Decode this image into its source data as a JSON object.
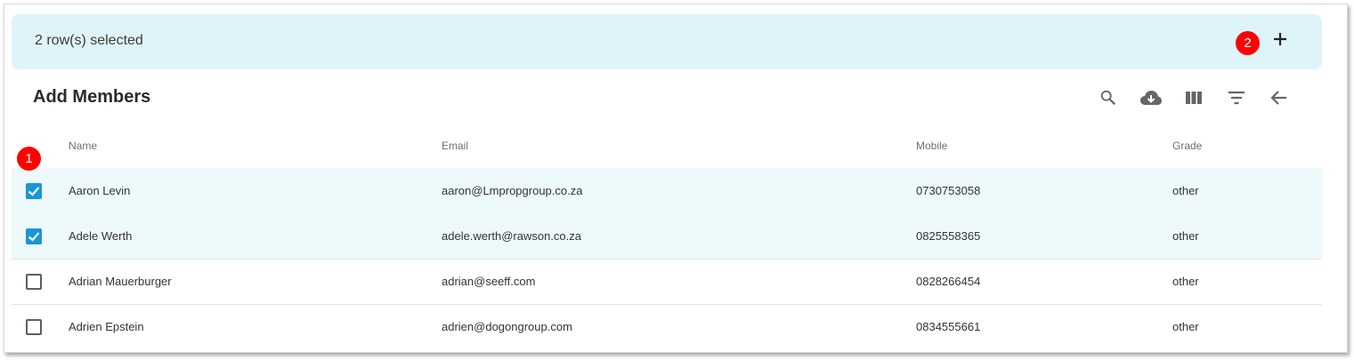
{
  "selection": {
    "text": "2 row(s) selected"
  },
  "markers": {
    "one": "1",
    "two": "2"
  },
  "title": "Add Members",
  "toolbar": [
    "search-icon",
    "cloud-download-icon",
    "view-column-icon",
    "filter-icon",
    "arrow-back-icon"
  ],
  "columns": {
    "name": "Name",
    "email": "Email",
    "mobile": "Mobile",
    "grade": "Grade"
  },
  "rows": [
    {
      "checked": true,
      "name": "Aaron Levin",
      "email": "aaron@Lmpropgroup.co.za",
      "mobile": "0730753058",
      "grade": "other"
    },
    {
      "checked": true,
      "name": "Adele Werth",
      "email": "adele.werth@rawson.co.za",
      "mobile": "0825558365",
      "grade": "other"
    },
    {
      "checked": false,
      "name": "Adrian Mauerburger",
      "email": "adrian@seeff.com",
      "mobile": "0828266454",
      "grade": "other"
    },
    {
      "checked": false,
      "name": "Adrien Epstein",
      "email": "adrien@dogongroup.com",
      "mobile": "0834555661",
      "grade": "other"
    }
  ],
  "colors": {
    "selection_bar": "#dff4f8",
    "selected_row": "#edf9fb",
    "checkbox": "#1797d7",
    "marker": "#ff0000"
  }
}
